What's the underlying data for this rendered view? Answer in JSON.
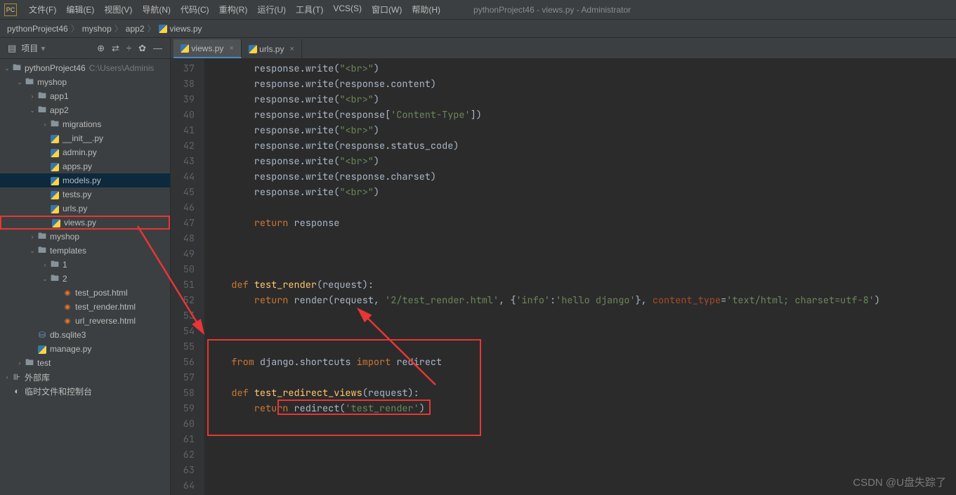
{
  "menubar": {
    "items": [
      "文件(F)",
      "编辑(E)",
      "视图(V)",
      "导航(N)",
      "代码(C)",
      "重构(R)",
      "运行(U)",
      "工具(T)",
      "VCS(S)",
      "窗口(W)",
      "帮助(H)"
    ],
    "title": "pythonProject46 - views.py - Administrator"
  },
  "breadcrumbs": {
    "items": [
      "pythonProject46",
      "myshop",
      "app2",
      "views.py"
    ]
  },
  "sidebar": {
    "title": "项目",
    "tree": [
      {
        "indent": 0,
        "chev": "v",
        "icon": "folder",
        "label": "pythonProject46",
        "extra": "C:\\Users\\Adminis"
      },
      {
        "indent": 1,
        "chev": "v",
        "icon": "folder",
        "label": "myshop"
      },
      {
        "indent": 2,
        "chev": ">",
        "icon": "folder",
        "label": "app1"
      },
      {
        "indent": 2,
        "chev": "v",
        "icon": "folder",
        "label": "app2"
      },
      {
        "indent": 3,
        "chev": ">",
        "icon": "folder",
        "label": "migrations"
      },
      {
        "indent": 3,
        "chev": "",
        "icon": "py",
        "label": "__init__.py"
      },
      {
        "indent": 3,
        "chev": "",
        "icon": "py",
        "label": "admin.py"
      },
      {
        "indent": 3,
        "chev": "",
        "icon": "py",
        "label": "apps.py"
      },
      {
        "indent": 3,
        "chev": "",
        "icon": "py",
        "label": "models.py",
        "selected": true
      },
      {
        "indent": 3,
        "chev": "",
        "icon": "py",
        "label": "tests.py"
      },
      {
        "indent": 3,
        "chev": "",
        "icon": "py",
        "label": "urls.py"
      },
      {
        "indent": 3,
        "chev": "",
        "icon": "py",
        "label": "views.py",
        "redbox": true
      },
      {
        "indent": 2,
        "chev": ">",
        "icon": "folder",
        "label": "myshop"
      },
      {
        "indent": 2,
        "chev": "v",
        "icon": "folder",
        "label": "templates"
      },
      {
        "indent": 3,
        "chev": ">",
        "icon": "folder",
        "label": "1"
      },
      {
        "indent": 3,
        "chev": "v",
        "icon": "folder",
        "label": "2"
      },
      {
        "indent": 4,
        "chev": "",
        "icon": "html",
        "label": "test_post.html"
      },
      {
        "indent": 4,
        "chev": "",
        "icon": "html",
        "label": "test_render.html"
      },
      {
        "indent": 4,
        "chev": "",
        "icon": "html",
        "label": "url_reverse.html"
      },
      {
        "indent": 2,
        "chev": "",
        "icon": "db",
        "label": "db.sqlite3"
      },
      {
        "indent": 2,
        "chev": "",
        "icon": "py",
        "label": "manage.py"
      },
      {
        "indent": 1,
        "chev": ">",
        "icon": "folder",
        "label": "test"
      },
      {
        "indent": 0,
        "chev": ">",
        "icon": "lib",
        "label": "外部库"
      },
      {
        "indent": 0,
        "chev": "",
        "icon": "scratch",
        "label": "临时文件和控制台"
      }
    ]
  },
  "tabs": [
    {
      "label": "views.py",
      "active": true
    },
    {
      "label": "urls.py",
      "active": false
    }
  ],
  "code": {
    "start": 37,
    "lines": [
      {
        "n": 37,
        "html": "        response.write(<span class='str'>\"&lt;br&gt;\"</span>)"
      },
      {
        "n": 38,
        "html": "        response.write(response.content)"
      },
      {
        "n": 39,
        "html": "        response.write(<span class='str'>\"&lt;br&gt;\"</span>)"
      },
      {
        "n": 40,
        "html": "        response.write(response[<span class='str'>'Content-Type'</span>])"
      },
      {
        "n": 41,
        "html": "        response.write(<span class='str'>\"&lt;br&gt;\"</span>)"
      },
      {
        "n": 42,
        "html": "        response.write(response.status_code)"
      },
      {
        "n": 43,
        "html": "        response.write(<span class='str'>\"&lt;br&gt;\"</span>)"
      },
      {
        "n": 44,
        "html": "        response.write(response.charset)"
      },
      {
        "n": 45,
        "html": "        response.write(<span class='str'>\"&lt;br&gt;\"</span>)"
      },
      {
        "n": 46,
        "html": ""
      },
      {
        "n": 47,
        "html": "        <span class='kw'>return</span> response"
      },
      {
        "n": 48,
        "html": ""
      },
      {
        "n": 49,
        "html": ""
      },
      {
        "n": 50,
        "html": ""
      },
      {
        "n": 51,
        "html": "    <span class='kw'>def</span> <span class='fn'>test_render</span>(request):"
      },
      {
        "n": 52,
        "html": "        <span class='kw'>return</span> render(request, <span class='str'>'2/test_render.html'</span>, {<span class='str'>'info'</span>:<span class='str'>'hello django'</span>}, <span style='color:#aa4926'>content_type</span>=<span class='str'>'text/html; charset=utf-8'</span>)"
      },
      {
        "n": 53,
        "html": ""
      },
      {
        "n": 54,
        "html": ""
      },
      {
        "n": 55,
        "html": ""
      },
      {
        "n": 56,
        "html": "    <span class='kw'>from</span> django.shortcuts <span class='kw'>import</span> redirect"
      },
      {
        "n": 57,
        "html": "    "
      },
      {
        "n": 58,
        "html": "    <span class='kw'>def</span> <span class='fn'>test_redirect_views</span>(request):"
      },
      {
        "n": 59,
        "html": "        <span class='kw'>return</span> redirect(<span class='str'>'test_render'</span>)"
      },
      {
        "n": 60,
        "html": ""
      },
      {
        "n": 61,
        "html": ""
      },
      {
        "n": 62,
        "html": ""
      },
      {
        "n": 63,
        "html": ""
      },
      {
        "n": 64,
        "html": ""
      }
    ]
  },
  "watermark": "CSDN @U盘失踪了"
}
